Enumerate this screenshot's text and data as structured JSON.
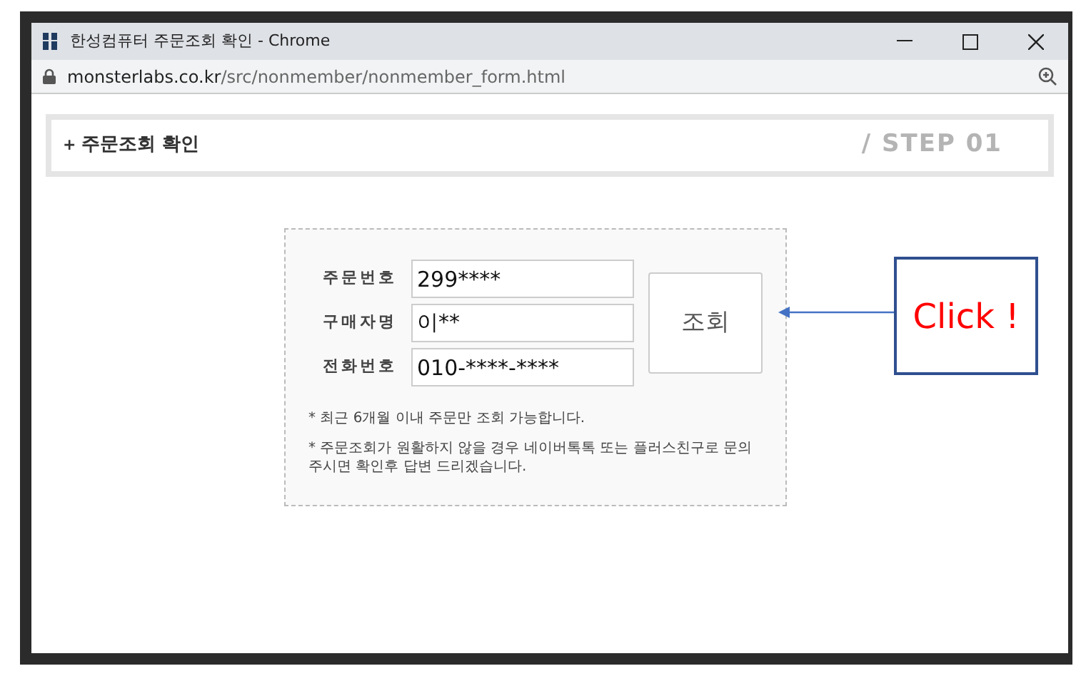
{
  "window": {
    "title": "한성컴퓨터 주문조회 확인 - Chrome",
    "url_domain": "monsterlabs.co.kr",
    "url_path": "/src/nonmember/nonmember_form.html"
  },
  "header": {
    "bullet": "+",
    "title": "주문조회 확인",
    "step": "/ STEP 01"
  },
  "form": {
    "fields": [
      {
        "label": "주문번호",
        "value": "299****"
      },
      {
        "label": "구매자명",
        "value": "이**"
      },
      {
        "label": "전화번호",
        "value": "010-****-****"
      }
    ],
    "button": "조회",
    "notes": [
      "* 최근 6개월 이내 주문만 조회 가능합니다.",
      "* 주문조회가 원활하지 않을 경우 네이버톡톡 또는 플러스친구로 문의주시면 확인후 답변 드리겠습니다."
    ]
  },
  "callout": {
    "text": "Click !"
  }
}
